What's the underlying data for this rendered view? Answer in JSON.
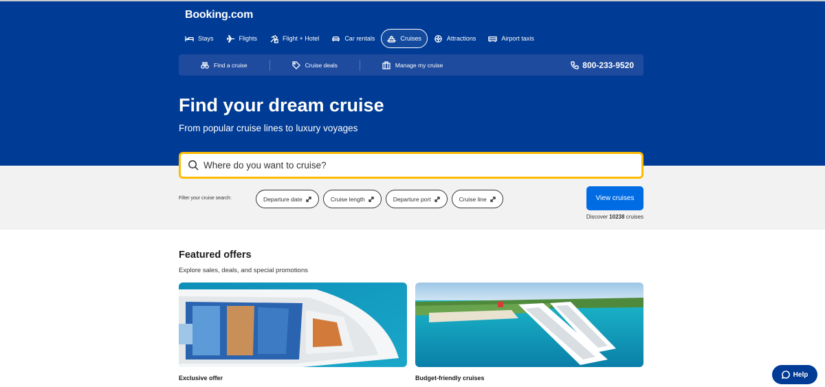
{
  "brand": {
    "logo": "Booking.com",
    "primary_color": "#003b95",
    "accent_color": "#febb02",
    "button_color": "#006ce4"
  },
  "nav": {
    "items": [
      {
        "label": "Stays",
        "icon": "bed-icon",
        "active": false
      },
      {
        "label": "Flights",
        "icon": "plane-icon",
        "active": false
      },
      {
        "label": "Flight + Hotel",
        "icon": "flight-hotel-icon",
        "active": false
      },
      {
        "label": "Car rentals",
        "icon": "car-icon",
        "active": false
      },
      {
        "label": "Cruises",
        "icon": "ship-icon",
        "active": true
      },
      {
        "label": "Attractions",
        "icon": "attractions-icon",
        "active": false
      },
      {
        "label": "Airport taxis",
        "icon": "taxi-icon",
        "active": false
      }
    ]
  },
  "subnav": {
    "items": [
      {
        "label": "Find a cruise",
        "icon": "binoculars-icon"
      },
      {
        "label": "Cruise deals",
        "icon": "tag-icon"
      },
      {
        "label": "Manage my cruise",
        "icon": "luggage-icon"
      }
    ],
    "phone": "800-233-9520"
  },
  "hero": {
    "title": "Find your dream cruise",
    "subtitle": "From popular cruise lines to luxury voyages"
  },
  "search": {
    "placeholder": "Where do you want to cruise?"
  },
  "filters": {
    "label": "Filter your cruise search:",
    "chips": [
      "Departure date",
      "Cruise length",
      "Departure port",
      "Cruise line"
    ]
  },
  "view_button": "View cruises",
  "discover": {
    "prefix": "Discover",
    "count": "10238",
    "suffix": "cruises"
  },
  "featured": {
    "title": "Featured offers",
    "subtitle": "Explore sales, deals, and special promotions",
    "cards": [
      {
        "caption": "Exclusive offer"
      },
      {
        "caption": "Budget-friendly cruises"
      }
    ]
  },
  "help": "Help"
}
